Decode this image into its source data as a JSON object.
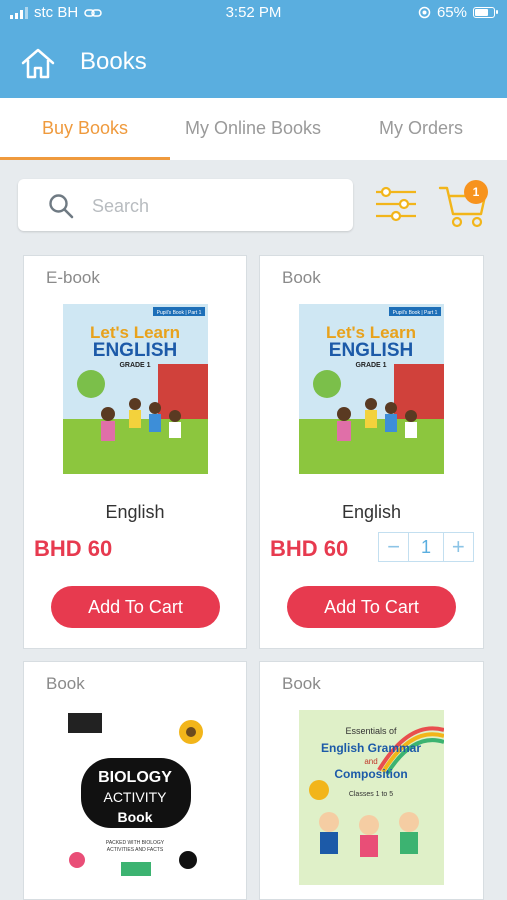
{
  "status_bar": {
    "carrier": "stc BH",
    "time": "3:52 PM",
    "battery": "65%"
  },
  "app_bar": {
    "title": "Books"
  },
  "tabs": [
    {
      "label": "Buy Books",
      "active": true
    },
    {
      "label": "My Online Books",
      "active": false
    },
    {
      "label": "My Orders",
      "active": false
    }
  ],
  "search": {
    "placeholder": "Search"
  },
  "cart": {
    "badge_count": "1"
  },
  "colors": {
    "primary": "#5aaedf",
    "accent": "#ef9a3d",
    "price": "#e73a4f",
    "badge": "#f7931e"
  },
  "books": [
    {
      "type": "E-book",
      "title": "English",
      "price": "BHD 60",
      "cta": "Add To Cart",
      "cover": {
        "label": "Pupil's Book | Part 1",
        "line1": "Let's Learn",
        "line2": "ENGLISH",
        "line3": "GRADE 1"
      }
    },
    {
      "type": "Book",
      "title": "English",
      "price": "BHD 60",
      "cta": "Add To Cart",
      "quantity": "1",
      "cover": {
        "label": "Pupil's Book | Part 1",
        "line1": "Let's Learn",
        "line2": "ENGLISH",
        "line3": "GRADE 1"
      }
    },
    {
      "type": "Book",
      "cover": {
        "line1": "BIOLOGY",
        "line2": "ACTIVITY",
        "line3": "Book",
        "line4": "PACKED WITH BIOLOGY",
        "line5": "ACTIVITIES AND FACTS"
      }
    },
    {
      "type": "Book",
      "cover": {
        "line1": "Essentials of",
        "line2": "English Grammar",
        "line3": "and",
        "line4": "Composition",
        "line5": "Classes 1 to 5"
      }
    }
  ]
}
